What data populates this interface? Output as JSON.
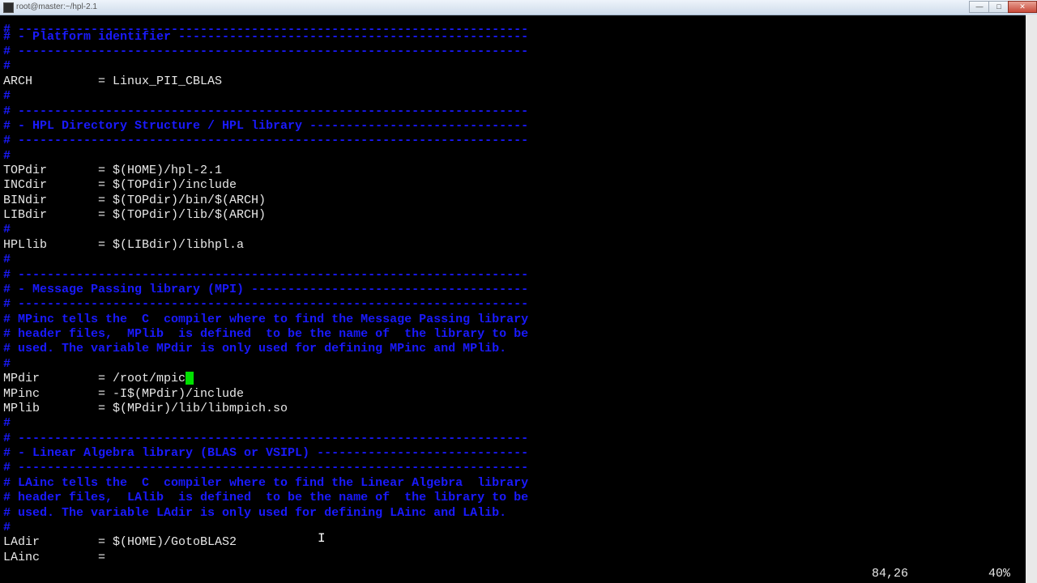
{
  "window": {
    "title": "root@master:~/hpl-2.1",
    "min": "—",
    "max": "□",
    "close": "✕"
  },
  "lines": {
    "l01": "# ----------------------------------------------------------------------",
    "l02": "# - Platform identifier ------------------------------------------------",
    "l03": "# ----------------------------------------------------------------------",
    "l04": "#",
    "l05": "ARCH         = Linux_PII_CBLAS",
    "l06": "#",
    "l07": "# ----------------------------------------------------------------------",
    "l08": "# - HPL Directory Structure / HPL library ------------------------------",
    "l09": "# ----------------------------------------------------------------------",
    "l10": "#",
    "l11": "TOPdir       = $(HOME)/hpl-2.1",
    "l12": "INCdir       = $(TOPdir)/include",
    "l13": "BINdir       = $(TOPdir)/bin/$(ARCH)",
    "l14": "LIBdir       = $(TOPdir)/lib/$(ARCH)",
    "l15": "#",
    "l16": "HPLlib       = $(LIBdir)/libhpl.a",
    "l17": "#",
    "l18": "# ----------------------------------------------------------------------",
    "l19": "# - Message Passing library (MPI) --------------------------------------",
    "l20": "# ----------------------------------------------------------------------",
    "l21": "# MPinc tells the  C  compiler where to find the Message Passing library",
    "l22": "# header files,  MPlib  is defined  to be the name of  the library to be",
    "l23": "# used. The variable MPdir is only used for defining MPinc and MPlib.",
    "l24": "#",
    "l25": "MPdir        = /root/mpic",
    "l26": "MPinc        = -I$(MPdir)/include",
    "l27": "MPlib        = $(MPdir)/lib/libmpich.so",
    "l28": "#",
    "l29": "# ----------------------------------------------------------------------",
    "l30": "# - Linear Algebra library (BLAS or VSIPL) -----------------------------",
    "l31": "# ----------------------------------------------------------------------",
    "l32": "# LAinc tells the  C  compiler where to find the Linear Algebra  library",
    "l33": "# header files,  LAlib  is defined  to be the name of  the library to be",
    "l34": "# used. The variable LAdir is only used for defining LAinc and LAlib.",
    "l35": "#",
    "l36": "LAdir        = $(HOME)/GotoBLAS2",
    "l37": "LAinc        ="
  },
  "status": {
    "position": "84,26",
    "percent": "40%"
  },
  "cursor_char": "h",
  "mouse_pointer": "I",
  "colors": {
    "comment": "#1a1aff",
    "text": "#e8e8e8",
    "cursor": "#00e000",
    "background": "#000000"
  }
}
